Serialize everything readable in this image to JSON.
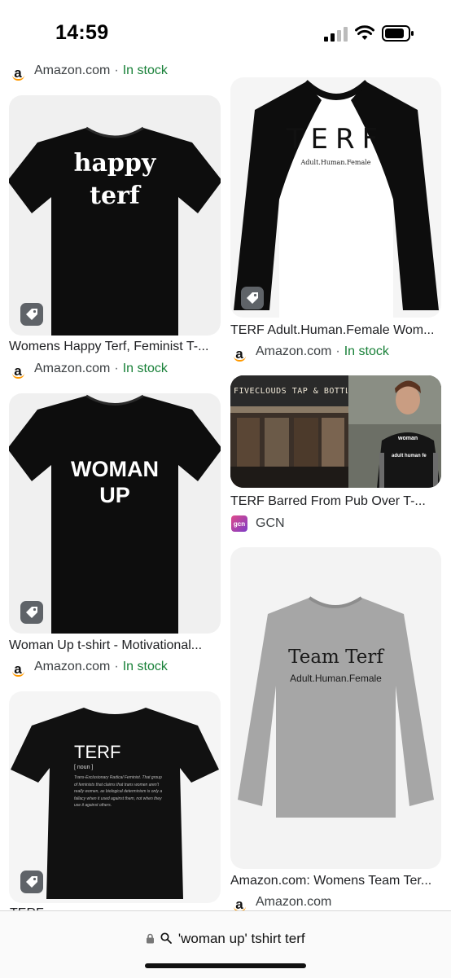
{
  "status": {
    "time": "14:59"
  },
  "top_source": {
    "name": "Amazon.com",
    "sep": "·",
    "stock": "In stock"
  },
  "results": [
    {
      "title": "Womens Happy Terf, Feminist T-...",
      "source": "Amazon.com",
      "sep": "·",
      "stock": "In stock",
      "shirt_text": [
        "happy",
        "terf"
      ],
      "icon": "amazon-icon"
    },
    {
      "title": "TERF Adult.Human.Female Wom...",
      "source": "Amazon.com",
      "sep": "·",
      "stock": "In stock",
      "shirt_text": [
        "TERF",
        "Adult.Human.Female"
      ],
      "icon": "amazon-icon"
    },
    {
      "title": "TERF Barred From Pub Over T-...",
      "source": "GCN",
      "sign_text": "FIVECLOUDS TAP & BOTTLE",
      "shirt_text": [
        "woman",
        "adult human fe"
      ],
      "icon_text": "gcn"
    },
    {
      "title": "Woman Up t-shirt - Motivational...",
      "source": "Amazon.com",
      "sep": "·",
      "stock": "In stock",
      "shirt_text": [
        "WOMAN",
        "UP"
      ],
      "icon": "amazon-icon"
    },
    {
      "title": "Amazon.com: Womens Team Ter...",
      "source": "Amazon.com",
      "shirt_text": [
        "Team Terf",
        "Adult.Human.Female"
      ],
      "icon": "amazon-icon"
    },
    {
      "title": "TERF",
      "shirt_text": [
        "TERF",
        "[ noun ]",
        "Trans-Exclusionary Radical Feminist. That group of feminists that claims that trans women aren't really women, as biological determinism is only a fallacy when it used against them, not when they use it against others."
      ]
    }
  ],
  "address_bar": {
    "text": "'woman up' tshirt terf",
    "icons": [
      "lock-icon",
      "search-icon"
    ]
  },
  "colors": {
    "in_stock": "#188038",
    "amazon_orange": "#ff9900",
    "tag_bg": "#5f6368"
  }
}
